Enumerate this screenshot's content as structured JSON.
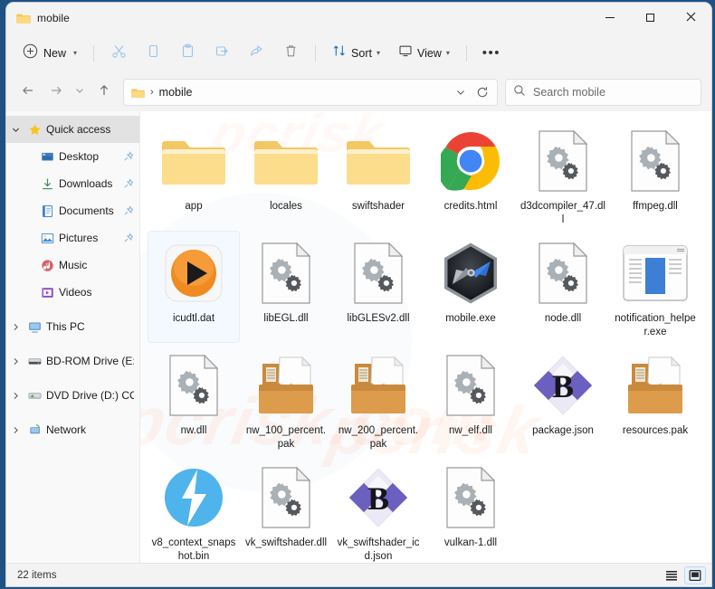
{
  "window": {
    "title": "mobile",
    "title_icon": "folder-icon",
    "controls": {
      "minimize": "minimize-icon",
      "maximize": "maximize-icon",
      "close": "close-icon"
    }
  },
  "toolbar": {
    "new_label": "New",
    "new_icon": "plus-circle-icon",
    "buttons": [
      {
        "name": "cut-button",
        "icon": "scissors-icon"
      },
      {
        "name": "copy-button",
        "icon": "copy-icon"
      },
      {
        "name": "paste-button",
        "icon": "clipboard-icon"
      },
      {
        "name": "rename-button",
        "icon": "rename-icon"
      },
      {
        "name": "share-button",
        "icon": "share-icon"
      },
      {
        "name": "delete-button",
        "icon": "trash-icon"
      }
    ],
    "sort_label": "Sort",
    "sort_icon": "sort-arrows-icon",
    "view_label": "View",
    "view_icon": "monitor-icon",
    "more_label": "•••"
  },
  "address": {
    "back_icon": "arrow-left-icon",
    "forward_icon": "arrow-right-icon",
    "recent_icon": "chevron-down-icon",
    "up_icon": "arrow-up-icon",
    "crumb_icon": "folder-icon",
    "crumb_separator": "›",
    "crumb_text": "mobile",
    "dropdown_icon": "chevron-down-icon",
    "refresh_icon": "refresh-icon"
  },
  "search": {
    "icon": "search-icon",
    "placeholder": "Search mobile"
  },
  "sidebar": {
    "items": [
      {
        "label": "Quick access",
        "icon": "star-icon",
        "twisty": "⌄",
        "expanded": true,
        "selected": true,
        "child": false,
        "pinned": false
      },
      {
        "label": "Desktop",
        "icon": "desktop-icon",
        "twisty": "",
        "expanded": false,
        "selected": false,
        "child": true,
        "pinned": true
      },
      {
        "label": "Downloads",
        "icon": "downloads-icon",
        "twisty": "",
        "expanded": false,
        "selected": false,
        "child": true,
        "pinned": true
      },
      {
        "label": "Documents",
        "icon": "documents-icon",
        "twisty": "",
        "expanded": false,
        "selected": false,
        "child": true,
        "pinned": true
      },
      {
        "label": "Pictures",
        "icon": "pictures-icon",
        "twisty": "",
        "expanded": false,
        "selected": false,
        "child": true,
        "pinned": true
      },
      {
        "label": "Music",
        "icon": "music-icon",
        "twisty": "",
        "expanded": false,
        "selected": false,
        "child": true,
        "pinned": false
      },
      {
        "label": "Videos",
        "icon": "videos-icon",
        "twisty": "",
        "expanded": false,
        "selected": false,
        "child": true,
        "pinned": false
      },
      {
        "label": "This PC",
        "icon": "this-pc-icon",
        "twisty": "›",
        "expanded": false,
        "selected": false,
        "child": false,
        "pinned": false
      },
      {
        "label": "BD-ROM Drive (E:) C",
        "icon": "bdrom-drive-icon",
        "twisty": "›",
        "expanded": false,
        "selected": false,
        "child": false,
        "pinned": false
      },
      {
        "label": "DVD Drive (D:) CCCC",
        "icon": "dvd-drive-icon",
        "twisty": "›",
        "expanded": false,
        "selected": false,
        "child": false,
        "pinned": false
      },
      {
        "label": "Network",
        "icon": "network-icon",
        "twisty": "›",
        "expanded": false,
        "selected": false,
        "child": false,
        "pinned": false
      }
    ]
  },
  "files": [
    {
      "name": "app",
      "icon": "folder-icon",
      "selected": false
    },
    {
      "name": "locales",
      "icon": "folder-icon",
      "selected": false
    },
    {
      "name": "swiftshader",
      "icon": "folder-icon",
      "selected": false
    },
    {
      "name": "credits.html",
      "icon": "chrome-icon",
      "selected": false
    },
    {
      "name": "d3dcompiler_47.dll",
      "icon": "dll-gears-icon",
      "selected": false
    },
    {
      "name": "ffmpeg.dll",
      "icon": "dll-gears-icon",
      "selected": false
    },
    {
      "name": "icudtl.dat",
      "icon": "orange-play-icon",
      "selected": true
    },
    {
      "name": "libEGL.dll",
      "icon": "dll-gears-icon",
      "selected": false
    },
    {
      "name": "libGLESv2.dll",
      "icon": "dll-gears-icon",
      "selected": false
    },
    {
      "name": "mobile.exe",
      "icon": "compass-hex-icon",
      "selected": false
    },
    {
      "name": "node.dll",
      "icon": "dll-gears-icon",
      "selected": false
    },
    {
      "name": "notification_helper.exe",
      "icon": "window-app-icon",
      "selected": false
    },
    {
      "name": "nw.dll",
      "icon": "dll-gears-icon",
      "selected": false
    },
    {
      "name": "nw_100_percent.pak",
      "icon": "pak-box-icon",
      "selected": false
    },
    {
      "name": "nw_200_percent.pak",
      "icon": "pak-box-icon",
      "selected": false
    },
    {
      "name": "nw_elf.dll",
      "icon": "dll-gears-icon",
      "selected": false
    },
    {
      "name": "package.json",
      "icon": "brackets-b-icon",
      "selected": false
    },
    {
      "name": "resources.pak",
      "icon": "pak-box-icon",
      "selected": false
    },
    {
      "name": "v8_context_snapshot.bin",
      "icon": "blue-bolt-icon",
      "selected": false
    },
    {
      "name": "vk_swiftshader.dll",
      "icon": "dll-gears-icon",
      "selected": false
    },
    {
      "name": "vk_swiftshader_icd.json",
      "icon": "brackets-b-icon",
      "selected": false
    },
    {
      "name": "vulkan-1.dll",
      "icon": "dll-gears-icon",
      "selected": false
    }
  ],
  "statusbar": {
    "item_count": "22 items",
    "list_view_icon": "list-view-icon",
    "tile_view_icon": "tile-view-icon"
  },
  "colors": {
    "window_frame": "#1f5185",
    "chrome_bg": "#f3f3f3",
    "content_bg": "#ffffff",
    "selection": "#f4f9ff",
    "accent_blue": "#0f6cbd",
    "folder_yellow": "#f6d074"
  }
}
